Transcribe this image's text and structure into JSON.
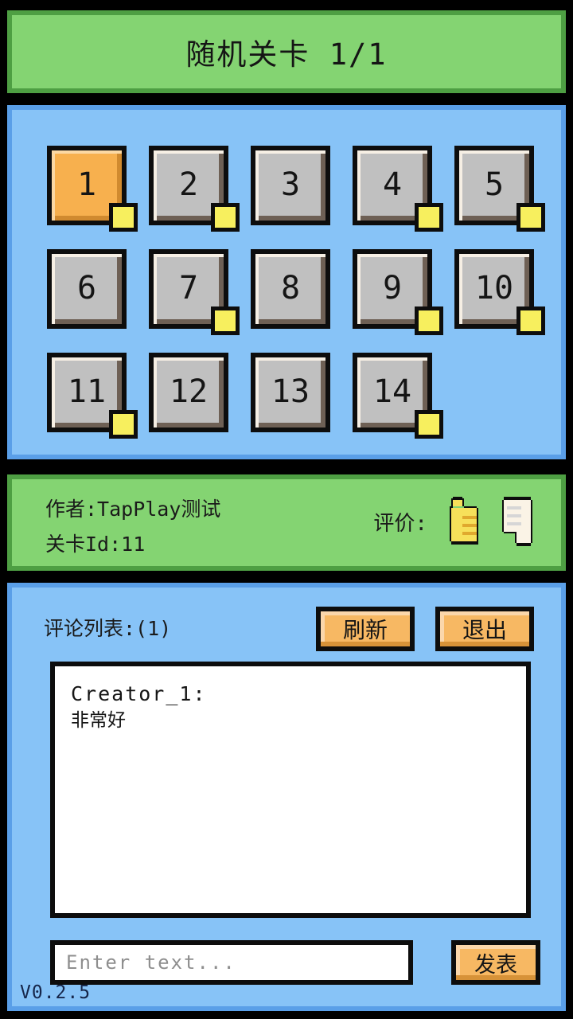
{
  "header": {
    "title": "随机关卡 1/1"
  },
  "levels": {
    "items": [
      {
        "label": "1",
        "selected": true,
        "badge": true
      },
      {
        "label": "2",
        "selected": false,
        "badge": true
      },
      {
        "label": "3",
        "selected": false,
        "badge": false
      },
      {
        "label": "4",
        "selected": false,
        "badge": true
      },
      {
        "label": "5",
        "selected": false,
        "badge": true
      },
      {
        "label": "6",
        "selected": false,
        "badge": false
      },
      {
        "label": "7",
        "selected": false,
        "badge": true
      },
      {
        "label": "8",
        "selected": false,
        "badge": false
      },
      {
        "label": "9",
        "selected": false,
        "badge": true
      },
      {
        "label": "10",
        "selected": false,
        "badge": true
      },
      {
        "label": "11",
        "selected": false,
        "badge": true
      },
      {
        "label": "12",
        "selected": false,
        "badge": false
      },
      {
        "label": "13",
        "selected": false,
        "badge": false
      },
      {
        "label": "14",
        "selected": false,
        "badge": true
      }
    ]
  },
  "info": {
    "author_line": "作者:TapPlay测试",
    "level_id_line": "关卡Id:11",
    "rating_label": "评价:",
    "thumb_up_icon": "thumbs-up-icon",
    "thumb_down_icon": "thumbs-down-icon"
  },
  "comments": {
    "title": "评论列表:(1)",
    "refresh_label": "刷新",
    "exit_label": "退出",
    "list": [
      {
        "author": "Creator_1:",
        "text": "非常好"
      }
    ],
    "input_value": "",
    "input_placeholder": "Enter text...",
    "post_label": "发表"
  },
  "footer": {
    "version": "V0.2.5"
  },
  "colors": {
    "header_fill": "#84d472",
    "header_border": "#4e9f43",
    "panel_fill": "#87c3f7",
    "panel_border": "#5a9fe8",
    "outline": "#0d0d0d",
    "selected_level": "#f7b04e",
    "level_fill": "#c0c0c0",
    "badge": "#f7ef5e",
    "button_orange": "#f7b863"
  }
}
